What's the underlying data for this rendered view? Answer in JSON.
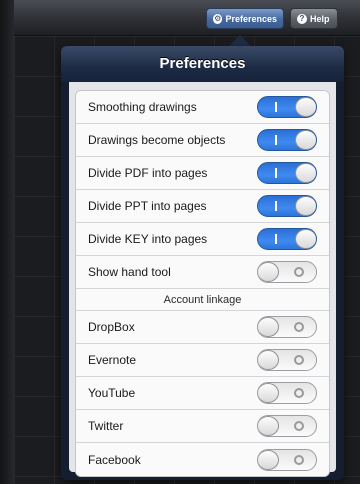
{
  "toolbar": {
    "preferences_label": "Preferences",
    "help_label": "Help",
    "preferences_icon": "gear-icon",
    "help_icon": "question-icon"
  },
  "popover": {
    "title": "Preferences"
  },
  "settings": [
    {
      "label": "Smoothing drawings",
      "on": true
    },
    {
      "label": "Drawings become objects",
      "on": true
    },
    {
      "label": "Divide PDF into pages",
      "on": true
    },
    {
      "label": "Divide PPT into pages",
      "on": true
    },
    {
      "label": "Divide KEY into pages",
      "on": true
    },
    {
      "label": "Show hand tool",
      "on": false
    }
  ],
  "account_section": {
    "title": "Account linkage",
    "items": [
      {
        "label": "DropBox",
        "on": false
      },
      {
        "label": "Evernote",
        "on": false
      },
      {
        "label": "YouTube",
        "on": false
      },
      {
        "label": "Twitter",
        "on": false
      },
      {
        "label": "Facebook",
        "on": false
      }
    ]
  },
  "colors": {
    "switch_on": "#3f8af0",
    "header": "#1d2b45"
  }
}
